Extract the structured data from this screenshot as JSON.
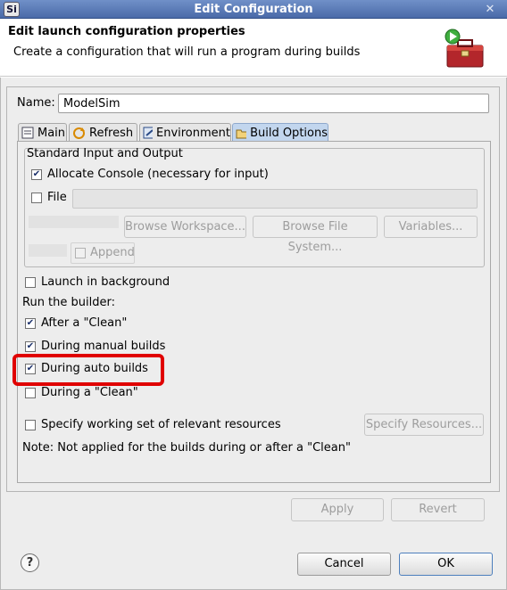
{
  "window": {
    "title": "Edit Configuration",
    "app_icon_text": "Si",
    "close_glyph": "✕"
  },
  "header": {
    "title": "Edit launch configuration properties",
    "description": "Create a configuration that will run a program during builds"
  },
  "name_field": {
    "label": "Name:",
    "value": "ModelSim"
  },
  "tabs": [
    {
      "label": "Main",
      "icon": "main-tab-icon",
      "active": false
    },
    {
      "label": "Refresh",
      "icon": "refresh-icon",
      "active": false
    },
    {
      "label": "Environment",
      "icon": "environment-icon",
      "active": false
    },
    {
      "label": "Build Options",
      "icon": "folder-icon",
      "active": true
    }
  ],
  "io_group": {
    "title": "Standard Input and Output",
    "allocate_console": {
      "label": "Allocate Console (necessary for input)",
      "checked": true
    },
    "file": {
      "label": "File",
      "checked": false,
      "value": ""
    },
    "buttons": {
      "browse_workspace": "Browse Workspace...",
      "browse_file_system": "Browse File System...",
      "variables": "Variables..."
    },
    "append": {
      "label": "Append",
      "checked": false
    }
  },
  "launch_background": {
    "label": "Launch in background",
    "checked": false
  },
  "run_builder_label": "Run the builder:",
  "builder_options": [
    {
      "label": "After a \"Clean\"",
      "checked": true
    },
    {
      "label": "During manual builds",
      "checked": true
    },
    {
      "label": "During auto builds",
      "checked": true
    },
    {
      "label": "During a \"Clean\"",
      "checked": false
    }
  ],
  "working_set": {
    "label": "Specify working set of relevant resources",
    "checked": false,
    "button": "Specify Resources..."
  },
  "note": "Note: Not applied for the builds during or after a \"Clean\"",
  "panel_buttons": {
    "apply": "Apply",
    "revert": "Revert"
  },
  "dialog_buttons": {
    "cancel": "Cancel",
    "ok": "OK"
  },
  "help_glyph": "?",
  "check_glyph": "✔",
  "colors": {
    "highlight": "#e00000",
    "titlebar": "#4a6aa8",
    "active_tab": "#c2d6ee"
  }
}
